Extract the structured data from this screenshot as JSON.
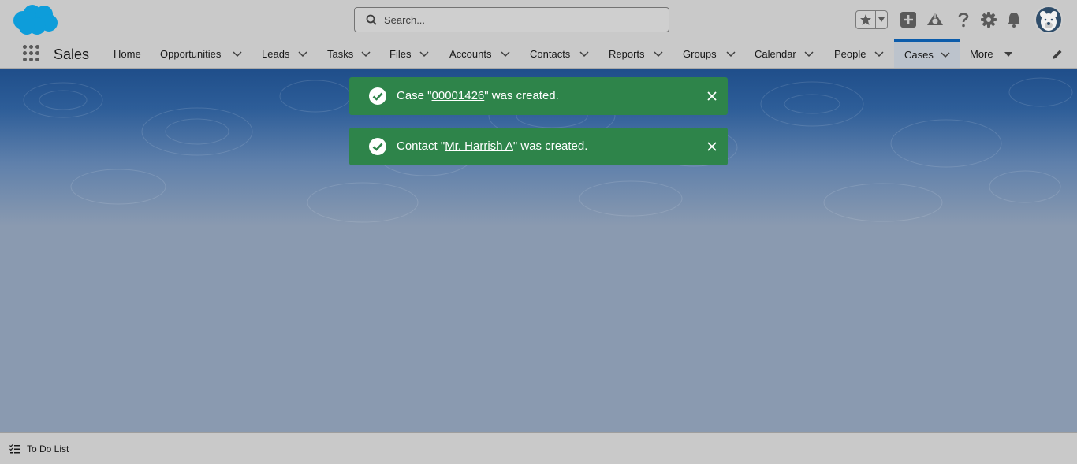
{
  "header": {
    "search_placeholder": "Search..."
  },
  "nav": {
    "app_name": "Sales",
    "items": [
      {
        "label": "Home"
      },
      {
        "label": "Opportunities"
      },
      {
        "label": "Leads"
      },
      {
        "label": "Tasks"
      },
      {
        "label": "Files"
      },
      {
        "label": "Accounts"
      },
      {
        "label": "Contacts"
      },
      {
        "label": "Reports"
      },
      {
        "label": "Groups"
      },
      {
        "label": "Calendar"
      },
      {
        "label": "People"
      },
      {
        "label": "Cases"
      },
      {
        "label": "More"
      }
    ],
    "active_item": "Cases"
  },
  "toasts": [
    {
      "prefix": "Case \"",
      "link": "00001426",
      "suffix": "\" was created."
    },
    {
      "prefix": "Contact \"",
      "link": "Mr. Harrish A",
      "suffix": "\" was created."
    }
  ],
  "utility_bar": {
    "todo_label": "To Do List"
  },
  "colors": {
    "brand": "#0b5cab",
    "success": "#2e844a",
    "header_bg": "#c9c9c9",
    "page_bg": "#8a9ab0"
  },
  "icons": [
    "salesforce-cloud-logo",
    "search-icon",
    "star-icon",
    "chevron-down-icon",
    "plus-icon",
    "trailhead-icon",
    "help-icon",
    "gear-icon",
    "bell-icon",
    "avatar",
    "app-launcher-icon",
    "pencil-icon",
    "check-circle-icon",
    "close-icon",
    "todo-list-icon"
  ]
}
